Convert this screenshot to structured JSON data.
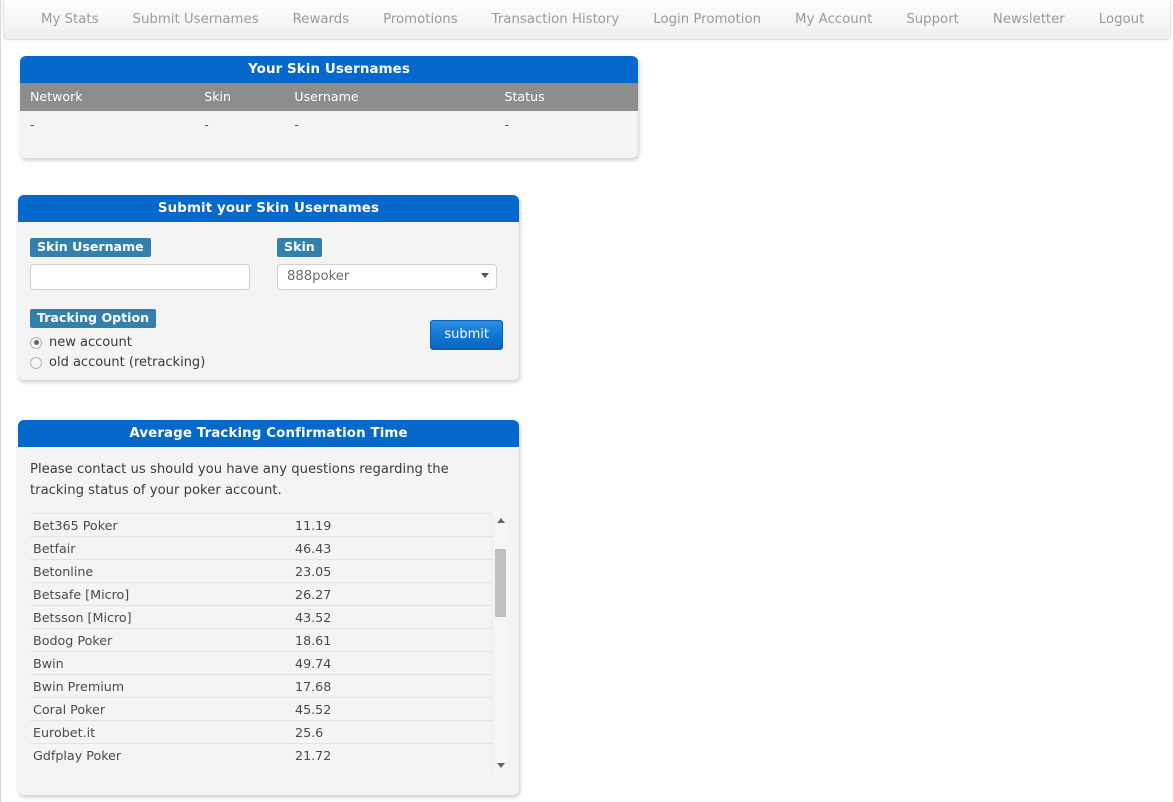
{
  "nav": {
    "items": [
      {
        "label": "My Stats"
      },
      {
        "label": "Submit Usernames"
      },
      {
        "label": "Rewards"
      },
      {
        "label": "Promotions"
      },
      {
        "label": "Transaction History"
      },
      {
        "label": "Login Promotion"
      },
      {
        "label": "My Account"
      },
      {
        "label": "Support"
      },
      {
        "label": "Newsletter"
      },
      {
        "label": "Logout"
      }
    ]
  },
  "colors": {
    "header_blue": "#0568cc",
    "label_blue": "#3380ad",
    "table_header_gray": "#8d8d8d",
    "nav_text": "#9b9b9b"
  },
  "usernames_panel": {
    "title": "Your Skin Usernames",
    "columns": [
      "Network",
      "Skin",
      "Username",
      "Status"
    ],
    "rows": [
      {
        "network": "-",
        "skin": "-",
        "username": "-",
        "status": "-"
      }
    ]
  },
  "submit_panel": {
    "title": "Submit your Skin Usernames",
    "username_label": "Skin Username",
    "username_value": "",
    "username_placeholder": "",
    "skin_label": "Skin",
    "skin_selected": "888poker",
    "skin_options": [
      "888poker"
    ],
    "tracking_label": "Tracking Option",
    "tracking_options": [
      {
        "label": "new account",
        "checked": true
      },
      {
        "label": "old account (retracking)",
        "checked": false
      }
    ],
    "submit_label": "submit"
  },
  "avgtime_panel": {
    "title": "Average Tracking Confirmation Time",
    "note": "Please contact us should you have any questions regarding the tracking status of your poker account.",
    "rows": [
      {
        "name": "Bet365 Poker",
        "time": "11.19"
      },
      {
        "name": "Betfair",
        "time": "46.43"
      },
      {
        "name": "Betonline",
        "time": "23.05"
      },
      {
        "name": "Betsafe [Micro]",
        "time": "26.27"
      },
      {
        "name": "Betsson [Micro]",
        "time": "43.52"
      },
      {
        "name": "Bodog Poker",
        "time": "18.61"
      },
      {
        "name": "Bwin",
        "time": "49.74"
      },
      {
        "name": "Bwin Premium",
        "time": "17.68"
      },
      {
        "name": "Coral Poker",
        "time": "45.52"
      },
      {
        "name": "Eurobet.it",
        "time": "25.6"
      },
      {
        "name": "Gdfplay Poker",
        "time": "21.72"
      }
    ]
  }
}
